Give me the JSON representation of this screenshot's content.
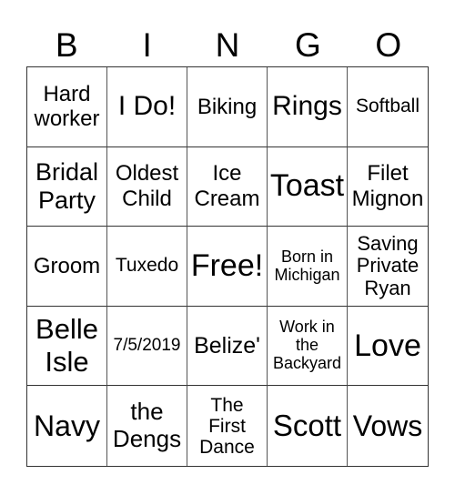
{
  "header": {
    "letters": [
      "B",
      "I",
      "N",
      "G",
      "O"
    ]
  },
  "cells": [
    [
      "Hard\nworker",
      "I Do!",
      "Biking",
      "Rings",
      "Softball"
    ],
    [
      "Bridal\nParty",
      "Oldest\nChild",
      "Ice\nCream",
      "Toast",
      "Filet\nMignon"
    ],
    [
      "Groom",
      "Tuxedo",
      "Free!",
      "Born in\nMichigan",
      "Saving\nPrivate\nRyan"
    ],
    [
      "Belle\nIsle",
      "7/5/2019",
      "Belize'",
      "Work in\nthe\nBackyard",
      "Love"
    ],
    [
      "Navy",
      "the\nDengs",
      "The\nFirst\nDance",
      "Scott",
      "Vows"
    ]
  ]
}
